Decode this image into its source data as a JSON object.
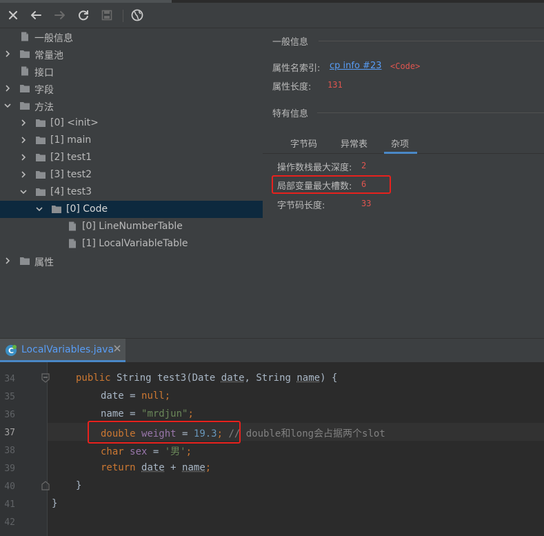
{
  "tree": {
    "items": [
      {
        "label": "一般信息",
        "type": "file",
        "indent": 0,
        "arrow": ""
      },
      {
        "label": "常量池",
        "type": "folder",
        "indent": 0,
        "arrow": "right"
      },
      {
        "label": "接口",
        "type": "file",
        "indent": 0,
        "arrow": ""
      },
      {
        "label": "字段",
        "type": "folder",
        "indent": 0,
        "arrow": "right"
      },
      {
        "label": "方法",
        "type": "folder",
        "indent": 0,
        "arrow": "down"
      },
      {
        "label": "[0] <init>",
        "type": "folder",
        "indent": 1,
        "arrow": "right"
      },
      {
        "label": "[1] main",
        "type": "folder",
        "indent": 1,
        "arrow": "right"
      },
      {
        "label": "[2] test1",
        "type": "folder",
        "indent": 1,
        "arrow": "right"
      },
      {
        "label": "[3] test2",
        "type": "folder",
        "indent": 1,
        "arrow": "right"
      },
      {
        "label": "[4] test3",
        "type": "folder",
        "indent": 1,
        "arrow": "down"
      },
      {
        "label": "[0] Code",
        "type": "folder",
        "indent": 2,
        "arrow": "down",
        "selected": true
      },
      {
        "label": "[0] LineNumberTable",
        "type": "file",
        "indent": 3,
        "arrow": ""
      },
      {
        "label": "[1] LocalVariableTable",
        "type": "file",
        "indent": 3,
        "arrow": ""
      },
      {
        "label": "属性",
        "type": "folder",
        "indent": 0,
        "arrow": "right"
      }
    ]
  },
  "general": {
    "title": "一般信息",
    "name_index_label": "属性名索引:",
    "name_index_link": "cp info #23",
    "name_index_value": "<Code>",
    "length_label": "属性长度:",
    "length_value": "131"
  },
  "specific": {
    "title": "特有信息",
    "tabs": [
      "字节码",
      "异常表",
      "杂项"
    ],
    "active_tab": "杂项",
    "max_stack_label": "操作数栈最大深度:",
    "max_stack_value": "2",
    "max_locals_label": "局部变量最大槽数:",
    "max_locals_value": "6",
    "code_length_label": "字节码长度:",
    "code_length_value": "33"
  },
  "editor": {
    "tab_label": "LocalVariables.java",
    "line_numbers": [
      "34",
      "35",
      "36",
      "37",
      "38",
      "39",
      "40",
      "41",
      "42"
    ],
    "current_line": "37",
    "code": {
      "l34": [
        "public",
        "String",
        "test3",
        "Date",
        "date",
        "String",
        "name"
      ],
      "l35": [
        "date",
        "null"
      ],
      "l36": [
        "name",
        "\"mrdjun\""
      ],
      "l37": [
        "double",
        "weight",
        "19.3",
        "// double和long会占据两个slot"
      ],
      "l38": [
        "char",
        "sex",
        "'男'"
      ],
      "l39": [
        "return",
        "date",
        "name"
      ]
    }
  },
  "colors": {
    "accent": "#4a88c7",
    "highlight_box": "#e8211d",
    "value_red": "#e0554f",
    "link_blue": "#589df6"
  }
}
